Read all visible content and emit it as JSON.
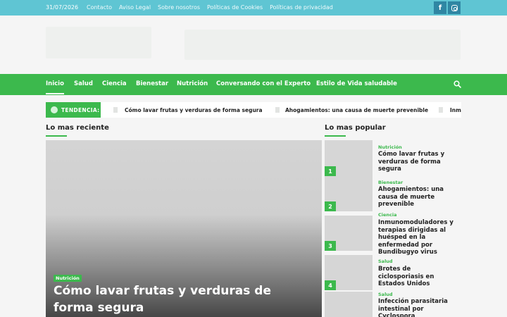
{
  "topbar": {
    "date": "31/07/2026",
    "links": [
      "Contacto",
      "Aviso Legal",
      "Sobre nosotros",
      "Políticas de Cookies",
      "Políticas de privacidad"
    ],
    "social": [
      "facebook-icon",
      "instagram-icon"
    ],
    "color": "#5fc5d3"
  },
  "nav": {
    "items": [
      "Inicio",
      "Salud",
      "Ciencia",
      "Bienestar",
      "Nutrición",
      "Conversando con el Experto",
      "Estilo de Vida saludable"
    ],
    "active": "Inicio",
    "search_icon": "search-icon",
    "color": "#3cb94d"
  },
  "ticker": {
    "label": "TENDENCIA:",
    "items": [
      "Cómo lavar frutas y verduras de forma segura",
      "Ahogamientos: una causa de muerte prevenible",
      "Inmu"
    ]
  },
  "latest": {
    "title": "Lo mas reciente",
    "hero": {
      "category": "Nutrición",
      "title": "Cómo lavar frutas y verduras de forma segura"
    }
  },
  "popular": {
    "title": "Lo mas popular",
    "items": [
      {
        "num": "1",
        "category": "Nutrición",
        "title": "Cómo lavar frutas y verduras de forma segura"
      },
      {
        "num": "2",
        "category": "Bienestar",
        "title": "Ahogamientos: una causa de muerte prevenible"
      },
      {
        "num": "3",
        "category": "Ciencia",
        "title": "Inmunomoduladores y terapias dirigidas al huésped en la enfermedad por Bundibugyo virus"
      },
      {
        "num": "4",
        "category": "Salud",
        "title": "Brotes de ciclosporiasis en Estados Unidos"
      },
      {
        "num": "",
        "category": "Salud",
        "title": "Infección parasitaria intestinal por Cyclospora"
      }
    ]
  }
}
